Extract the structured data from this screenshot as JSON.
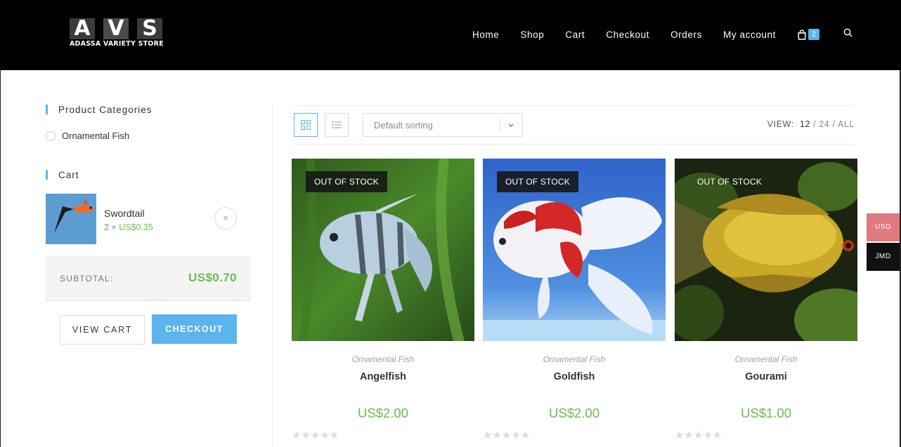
{
  "logo": {
    "letters": [
      "A",
      "V",
      "S"
    ],
    "subtitle": "ADASSA VARIETY STORE"
  },
  "nav": {
    "items": [
      "Home",
      "Shop",
      "Cart",
      "Checkout",
      "Orders",
      "My account"
    ],
    "cart_count": "2",
    "cart_icon": "shopping-bag-icon",
    "search_icon": "search-icon"
  },
  "sidebar": {
    "categories_title": "Product Categories",
    "categories": [
      "Ornamental Fish"
    ],
    "cart_title": "Cart",
    "cart_item": {
      "name": "Swordtail",
      "qty_prefix": "2 × ",
      "price": "US$0.35"
    },
    "remove_symbol": "×",
    "subtotal_label": "SUBTOTAL:",
    "subtotal_value": "US$0.70",
    "view_cart": "VIEW CART",
    "checkout": "CHECKOUT"
  },
  "toolbar": {
    "sort_label": "Default sorting",
    "view_label": "VIEW:",
    "view_options": [
      "12",
      "24",
      "ALL"
    ],
    "view_sep": "/"
  },
  "products": [
    {
      "badge": "OUT OF STOCK",
      "category": "Ornamental Fish",
      "name": "Angelfish",
      "price": "US$2.00",
      "rating": 0
    },
    {
      "badge": "OUT OF STOCK",
      "category": "Ornamental Fish",
      "name": "Goldfish",
      "price": "US$2.00",
      "rating": 0
    },
    {
      "badge": "OUT OF STOCK",
      "category": "Ornamental Fish",
      "name": "Gourami",
      "price": "US$1.00",
      "rating": 0
    }
  ],
  "stars": "★★★★★",
  "currency": [
    "USD",
    "JMD"
  ],
  "colors": {
    "accent": "#5bb4ee",
    "price": "#6bbb4f",
    "header": "#000000",
    "usd": "#e07a7f"
  }
}
